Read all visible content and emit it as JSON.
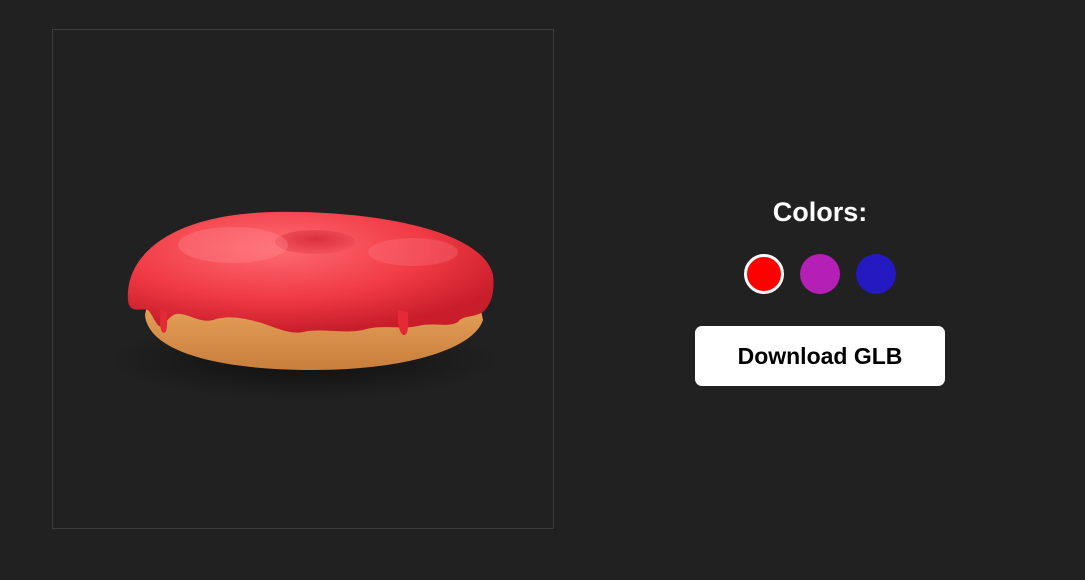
{
  "viewer": {
    "model": "donut-icon",
    "glaze_color": "#f03a45",
    "dough_color": "#d9904a"
  },
  "panel": {
    "title": "Colors:",
    "swatches": [
      {
        "name": "red",
        "color": "#ff0000",
        "selected": true
      },
      {
        "name": "purple",
        "color": "#b51fb5",
        "selected": false
      },
      {
        "name": "blue",
        "color": "#2519c2",
        "selected": false
      }
    ],
    "download_label": "Download GLB"
  },
  "colors": {
    "background": "#212121",
    "button_bg": "#ffffff",
    "button_text": "#000000"
  }
}
